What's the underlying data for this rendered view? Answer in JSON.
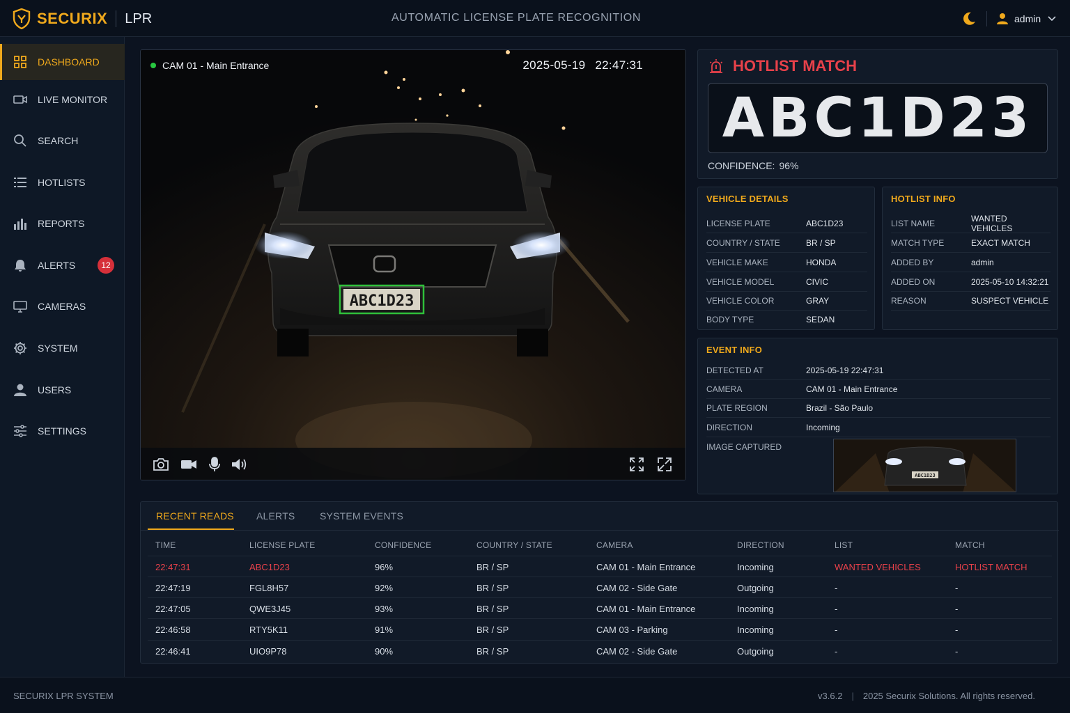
{
  "header": {
    "brand": "SECURIX",
    "product": "LPR",
    "title": "AUTOMATIC LICENSE PLATE RECOGNITION",
    "user": "admin",
    "icons": {
      "logo": "shield-icon",
      "theme": "moon-icon",
      "user": "user-icon"
    }
  },
  "colors": {
    "accent": "#f0a91c",
    "alert": "#e8414a",
    "live": "#28c840",
    "detect": "#2fbf3a"
  },
  "sidebar": {
    "items": [
      {
        "label": "DASHBOARD",
        "icon": "grid-icon"
      },
      {
        "label": "LIVE MONITOR",
        "icon": "camera-icon"
      },
      {
        "label": "SEARCH",
        "icon": "search-icon"
      },
      {
        "label": "HOTLISTS",
        "icon": "list-icon"
      },
      {
        "label": "REPORTS",
        "icon": "chart-icon"
      },
      {
        "label": "ALERTS",
        "icon": "bell-icon",
        "badge": "12"
      },
      {
        "label": "CAMERAS",
        "icon": "monitor-icon"
      },
      {
        "label": "SYSTEM",
        "icon": "gear-icon"
      },
      {
        "label": "USERS",
        "icon": "user-icon"
      },
      {
        "label": "SETTINGS",
        "icon": "sliders-icon"
      }
    ]
  },
  "video": {
    "camera": "CAM 01 - Main Entrance",
    "date": "2025-05-19",
    "time": "22:47:31",
    "plate_overlay": "ABC1D23"
  },
  "hotlist_match": {
    "title": "HOTLIST MATCH",
    "plate": "ABC1D23",
    "confidence_label": "CONFIDENCE:",
    "confidence_value": "96%"
  },
  "vehicle_details": {
    "title": "VEHICLE DETAILS",
    "rows": [
      {
        "k": "LICENSE PLATE",
        "v": "ABC1D23"
      },
      {
        "k": "COUNTRY / STATE",
        "v": "BR / SP"
      },
      {
        "k": "VEHICLE MAKE",
        "v": "HONDA"
      },
      {
        "k": "VEHICLE MODEL",
        "v": "CIVIC"
      },
      {
        "k": "VEHICLE COLOR",
        "v": "GRAY"
      },
      {
        "k": "BODY TYPE",
        "v": "SEDAN"
      }
    ]
  },
  "hotlist_info": {
    "title": "HOTLIST INFO",
    "rows": [
      {
        "k": "LIST NAME",
        "v": "WANTED VEHICLES"
      },
      {
        "k": "MATCH TYPE",
        "v": "EXACT MATCH"
      },
      {
        "k": "ADDED BY",
        "v": "admin"
      },
      {
        "k": "ADDED ON",
        "v": "2025-05-10 14:32:21"
      },
      {
        "k": "REASON",
        "v": "SUSPECT VEHICLE"
      }
    ]
  },
  "event_info": {
    "title": "EVENT INFO",
    "rows": [
      {
        "k": "DETECTED AT",
        "v": "2025-05-19 22:47:31"
      },
      {
        "k": "CAMERA",
        "v": "CAM 01 - Main Entrance"
      },
      {
        "k": "PLATE REGION",
        "v": "Brazil - São Paulo"
      },
      {
        "k": "DIRECTION",
        "v": "Incoming"
      }
    ],
    "image_label": "IMAGE CAPTURED",
    "thumb_plate": "ABC1D23"
  },
  "reads": {
    "tabs": [
      "RECENT READS",
      "ALERTS",
      "SYSTEM EVENTS"
    ],
    "columns": [
      "TIME",
      "LICENSE PLATE",
      "CONFIDENCE",
      "COUNTRY / STATE",
      "CAMERA",
      "DIRECTION",
      "LIST",
      "MATCH"
    ],
    "rows": [
      [
        "22:47:31",
        "ABC1D23",
        "96%",
        "BR / SP",
        "CAM 01 - Main Entrance",
        "Incoming",
        "WANTED VEHICLES",
        "HOTLIST MATCH"
      ],
      [
        "22:47:19",
        "FGL8H57",
        "92%",
        "BR / SP",
        "CAM 02 - Side Gate",
        "Outgoing",
        "-",
        "-"
      ],
      [
        "22:47:05",
        "QWE3J45",
        "93%",
        "BR / SP",
        "CAM 01 - Main Entrance",
        "Incoming",
        "-",
        "-"
      ],
      [
        "22:46:58",
        "RTY5K11",
        "91%",
        "BR / SP",
        "CAM 03 - Parking",
        "Incoming",
        "-",
        "-"
      ],
      [
        "22:46:41",
        "UIO9P78",
        "90%",
        "BR / SP",
        "CAM 02 - Side Gate",
        "Outgoing",
        "-",
        "-"
      ]
    ]
  },
  "footer": {
    "system": "SECURIX LPR SYSTEM",
    "version": "v3.6.2",
    "copyright": "2025 Securix Solutions. All rights reserved."
  }
}
